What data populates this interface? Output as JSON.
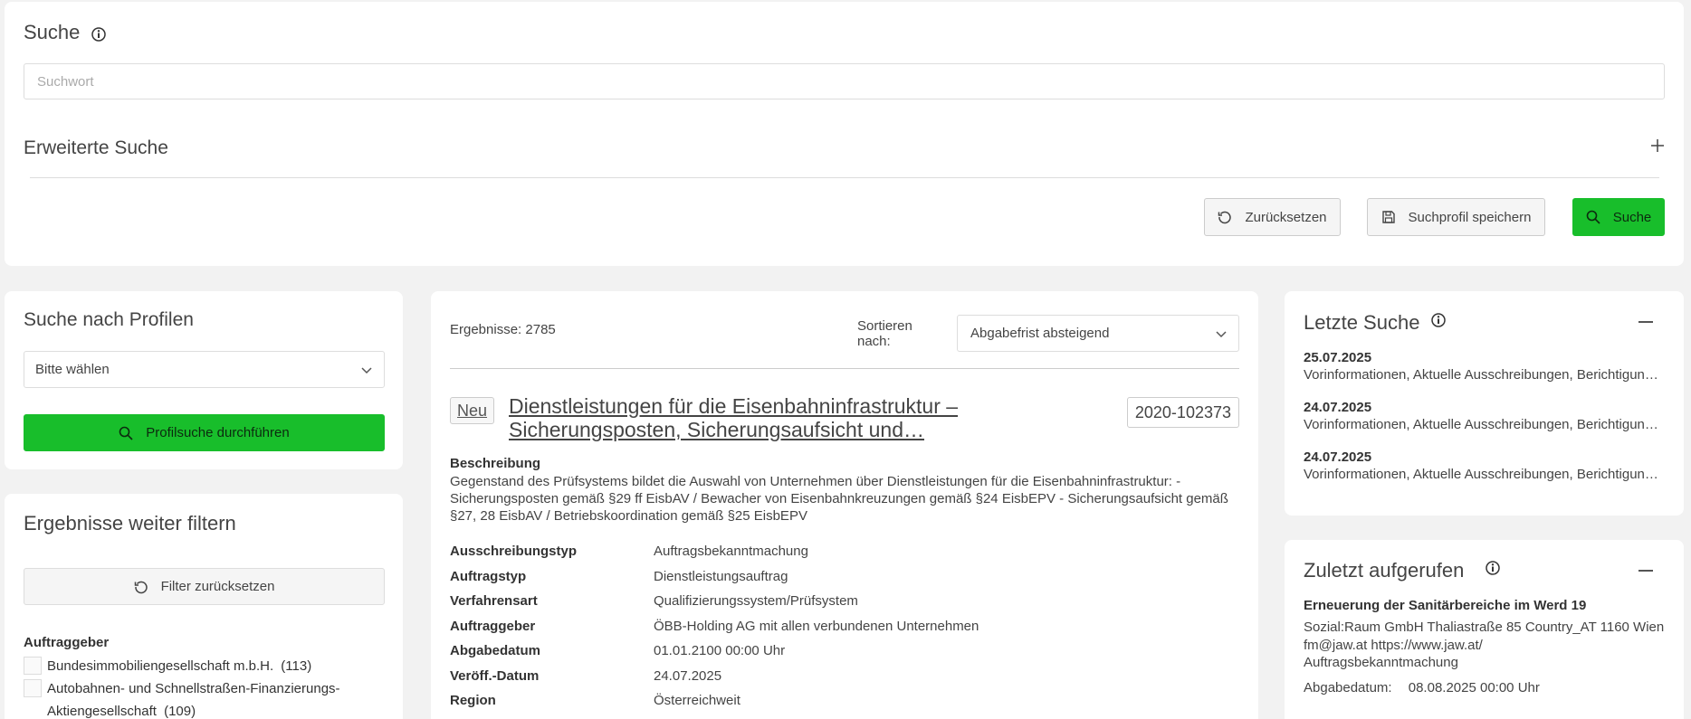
{
  "search": {
    "title": "Suche",
    "placeholder": "Suchwort",
    "advanced_label": "Erweiterte Suche",
    "reset_label": "Zurücksetzen",
    "save_profile_label": "Suchprofil speichern",
    "search_label": "Suche"
  },
  "profiles": {
    "title": "Suche nach Profilen",
    "select_value": "Bitte wählen",
    "run_label": "Profilsuche durchführen"
  },
  "filters": {
    "title": "Ergebnisse weiter filtern",
    "reset_label": "Filter zurücksetzen",
    "group_label": "Auftraggeber",
    "items": [
      {
        "label": "Bundesimmobiliengesellschaft m.b.H.",
        "count": "(113)"
      },
      {
        "label": "Autobahnen- und Schnellstraßen-Finanzierungs-",
        "label2": "Aktiengesellschaft",
        "count": "(109)"
      }
    ]
  },
  "results": {
    "count_text": "Ergebnisse: 2785",
    "sort_label_line1": "Sortieren",
    "sort_label_line2": "nach:",
    "sort_value": "Abgabefrist absteigend",
    "item": {
      "badge": "Neu",
      "title_line1": "Dienstleistungen für die Eisenbahninfrastruktur –",
      "title_line2": "Sicherungsposten, Sicherungsaufsicht und…",
      "id": "2020-102373",
      "description_label": "Beschreibung",
      "description": "Gegenstand des Prüfsystems bildet die Auswahl von Unternehmen über Dienstleistungen für die Eisenbahninfrastruktur: - Sicherungsposten gemäß §29 ff EisbAV / Bewacher von Eisenbahnkreuzungen gemäß §24 EisbEPV - Sicherungsaufsicht gemäß §27, 28 EisbAV / Betriebskoordination gemäß §25 EisbEPV",
      "details": [
        {
          "key": "Ausschreibungstyp",
          "value": "Auftragsbekanntmachung"
        },
        {
          "key": "Auftragstyp",
          "value": "Dienstleistungsauftrag"
        },
        {
          "key": "Verfahrensart",
          "value": "Qualifizierungssystem/Prüfsystem"
        },
        {
          "key": "Auftraggeber",
          "value": "ÖBB-Holding AG mit allen verbundenen Unternehmen"
        },
        {
          "key": "Abgabedatum",
          "value": "01.01.2100 00:00 Uhr"
        },
        {
          "key": "Veröff.-Datum",
          "value": "24.07.2025"
        },
        {
          "key": "Region",
          "value": "Österreichweit"
        }
      ]
    }
  },
  "recent_searches": {
    "title": "Letzte Suche",
    "items": [
      {
        "date": "25.07.2025",
        "text": "Vorinformationen, Aktuelle Ausschreibungen, Berichtigungen, Vergebene Aufträge"
      },
      {
        "date": "24.07.2025",
        "text": "Vorinformationen, Aktuelle Ausschreibungen, Berichtigungen, Vergebene Aufträge"
      },
      {
        "date": "24.07.2025",
        "text": "Vorinformationen, Aktuelle Ausschreibungen, Berichtigungen, Vergebene Aufträge"
      }
    ]
  },
  "recently_viewed": {
    "title": "Zuletzt aufgerufen",
    "item_title": "Erneuerung der Sanitärbereiche im Werd 19",
    "line1": "Sozial:Raum GmbH Thaliastraße 85 Country_AT 1160 Wien",
    "line2": "fm@jaw.at https://www.jaw.at/",
    "line3": "Auftragsbekanntmachung",
    "date_label": "Abgabedatum:",
    "date_value": "08.08.2025 00:00 Uhr"
  },
  "colors": {
    "accent_green": "#18be2b"
  },
  "icons": [
    "info-icon",
    "plus-icon",
    "reset-icon",
    "save-icon",
    "search-icon",
    "chevron-down-icon",
    "minus-icon"
  ]
}
